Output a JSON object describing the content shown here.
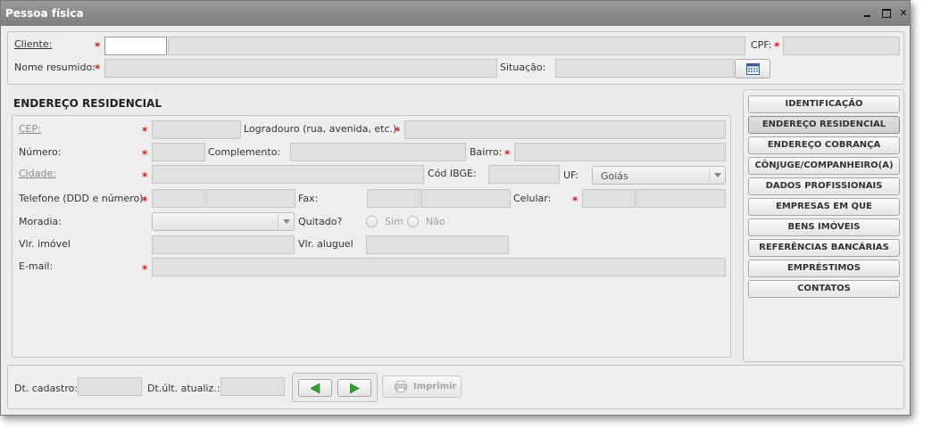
{
  "window": {
    "title": "Pessoa física"
  },
  "header": {
    "cliente_label": "Cliente:",
    "cpf_label": "CPF:",
    "nome_resumido_label": "Nome resumido:",
    "situacao_label": "Situação:"
  },
  "section": {
    "title": "ENDEREÇO RESIDENCIAL"
  },
  "form": {
    "cep_label": "CEP:",
    "logradouro_label": "Logradouro (rua, avenida, etc.)",
    "numero_label": "Número:",
    "complemento_label": "Complemento:",
    "bairro_label": "Bairro:",
    "cidade_label": "Cidade:",
    "cod_ibge_label": "Cód IBGE:",
    "uf_label": "UF:",
    "uf_value": "Goiás",
    "telefone_label": "Telefone (DDD e número):",
    "fax_label": "Fax:",
    "celular_label": "Celular:",
    "moradia_label": "Moradia:",
    "quitado_label": "Quitado?",
    "sim_label": "Sim",
    "nao_label": "Não",
    "vlr_imovel_label": "Vlr. imóvel",
    "vlr_aluguel_label": "Vlr. aluguel",
    "email_label": "E-mail:",
    "required_mark": "*"
  },
  "nav": {
    "items": [
      "IDENTIFICAÇÃO",
      "ENDEREÇO RESIDENCIAL",
      "ENDEREÇO COBRANÇA",
      "CÔNJUGE/COMPANHEIRO(A)",
      "DADOS PROFISSIONAIS",
      "EMPRESAS EM QUE PARTICIPA",
      "BENS IMÓVEIS",
      "REFERÊNCIAS BANCÁRIAS",
      "EMPRÉSTIMOS",
      "CONTATOS"
    ],
    "active_index": 1
  },
  "footer": {
    "dt_cadastro_label": "Dt. cadastro:",
    "dt_ult_atualiz_label": "Dt.últ. atualiz.:",
    "print_label": "Imprimir"
  },
  "colors": {
    "required": "#d42020",
    "nav_arrow": "#2ea02e"
  },
  "icons": [
    "minimize-icon",
    "maximize-icon",
    "close-icon",
    "calendar-icon",
    "arrow-left-icon",
    "arrow-right-icon",
    "printer-icon",
    "chevron-down-icon"
  ]
}
